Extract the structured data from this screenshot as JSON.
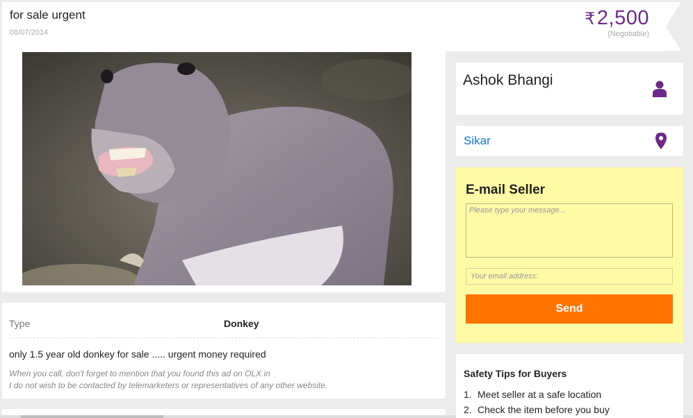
{
  "listing": {
    "title": "for sale urgent",
    "date": "08/07/2014",
    "currency_symbol": "₹",
    "price": "2,500",
    "negotiable": "(Negotiable)"
  },
  "photo": {
    "icon": "donkey-photo"
  },
  "details": {
    "type_label": "Type",
    "type_value": "Donkey",
    "description": "only 1.5 year old donkey for sale ..... urgent money required",
    "note_line1": "When you call, don't forget to mention that you found this ad on OLX.in",
    "note_line2": "I do not wish to be contacted by telemarketers or representatives of any other website."
  },
  "seller": {
    "name": "Ashok Bhangi",
    "icon": "user-icon"
  },
  "location": {
    "name": "Sikar",
    "icon": "map-pin-icon"
  },
  "email_seller": {
    "title": "E-mail Seller",
    "message_placeholder": "Please type your message...",
    "email_placeholder": "Your email address:",
    "send_label": "Send"
  },
  "safety_tips": {
    "title": "Safety Tips for Buyers",
    "items": [
      {
        "num": "1.",
        "text": "Meet seller at a safe location"
      },
      {
        "num": "2.",
        "text": "Check the item before you buy"
      }
    ]
  },
  "colors": {
    "accent_purple": "#6b2a86",
    "send_orange": "#ff7300",
    "email_panel_yellow": "#fffaa6",
    "link_blue": "#1a73c6"
  }
}
